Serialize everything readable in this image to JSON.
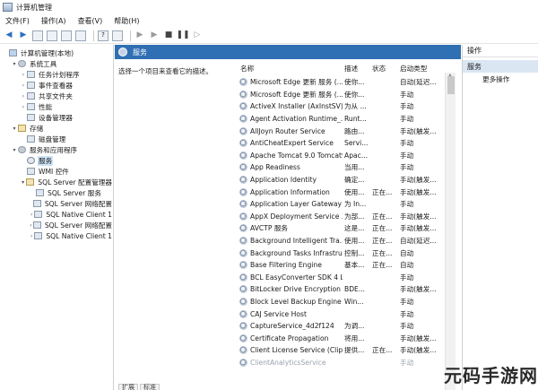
{
  "window": {
    "title": "计算机管理"
  },
  "menu": [
    "文件(F)",
    "操作(A)",
    "查看(V)",
    "帮助(H)"
  ],
  "toolbar": {
    "icons": [
      "back-arrow-icon",
      "forward-arrow-icon",
      "folder-icon",
      "properties-icon",
      "refresh-icon",
      "export-icon",
      "help-icon",
      "console-icon",
      "play-icon",
      "play-alt-icon",
      "stop-icon",
      "pause-icon",
      "restart-icon"
    ]
  },
  "tree": {
    "items": [
      {
        "label": "计算机管理(本地)",
        "indent": 0,
        "arrow": "",
        "icon": "mon"
      },
      {
        "label": "系统工具",
        "indent": 1,
        "arrow": "v",
        "icon": "gear"
      },
      {
        "label": "任务计划程序",
        "indent": 2,
        "arrow": ">",
        "icon": "box"
      },
      {
        "label": "事件查看器",
        "indent": 2,
        "arrow": ">",
        "icon": "box"
      },
      {
        "label": "共享文件夹",
        "indent": 2,
        "arrow": ">",
        "icon": "box"
      },
      {
        "label": "性能",
        "indent": 2,
        "arrow": ">",
        "icon": "box"
      },
      {
        "label": "设备管理器",
        "indent": 2,
        "arrow": "",
        "icon": "box"
      },
      {
        "label": "存储",
        "indent": 1,
        "arrow": "v",
        "icon": "db"
      },
      {
        "label": "磁盘管理",
        "indent": 2,
        "arrow": "",
        "icon": "box"
      },
      {
        "label": "服务和应用程序",
        "indent": 1,
        "arrow": "v",
        "icon": "gear"
      },
      {
        "label": "服务",
        "indent": 2,
        "arrow": "",
        "icon": "svc",
        "selected": true
      },
      {
        "label": "WMI 控件",
        "indent": 2,
        "arrow": "",
        "icon": "box"
      },
      {
        "label": "SQL Server 配置管理器",
        "indent": 2,
        "arrow": "v",
        "icon": "db"
      },
      {
        "label": "SQL Server 服务",
        "indent": 3,
        "arrow": "",
        "icon": "box"
      },
      {
        "label": "SQL Server 网络配置",
        "indent": 3,
        "arrow": "",
        "icon": "box"
      },
      {
        "label": "SQL Native Client 1",
        "indent": 3,
        "arrow": ">",
        "icon": "box"
      },
      {
        "label": "SQL Server 网络配置",
        "indent": 3,
        "arrow": ">",
        "icon": "box"
      },
      {
        "label": "SQL Native Client 1",
        "indent": 3,
        "arrow": ">",
        "icon": "box"
      }
    ]
  },
  "services_panel": {
    "header": "服务",
    "description_hint": "选择一个项目来查看它的描述。",
    "columns": {
      "name": "名称",
      "desc": "描述",
      "status": "状态",
      "startup": "启动类型"
    },
    "rows": [
      {
        "name": "Microsoft Edge 更新 服务 (...",
        "desc": "使你...",
        "status": "",
        "startup": "自动(延迟..."
      },
      {
        "name": "Microsoft Edge 更新 服务 (...",
        "desc": "使你...",
        "status": "",
        "startup": "手动"
      },
      {
        "name": "ActiveX Installer (AxInstSV)",
        "desc": "为从 ...",
        "status": "",
        "startup": "手动"
      },
      {
        "name": "Agent Activation Runtime_...",
        "desc": "Runt...",
        "status": "",
        "startup": "手动"
      },
      {
        "name": "AllJoyn Router Service",
        "desc": "路由...",
        "status": "",
        "startup": "手动(触发..."
      },
      {
        "name": "AntiCheatExpert Service",
        "desc": "Servi...",
        "status": "",
        "startup": "手动"
      },
      {
        "name": "Apache Tomcat 9.0 Tomcat9",
        "desc": "Apac...",
        "status": "",
        "startup": "手动"
      },
      {
        "name": "App Readiness",
        "desc": "当用...",
        "status": "",
        "startup": "手动"
      },
      {
        "name": "Application Identity",
        "desc": "确定...",
        "status": "",
        "startup": "手动(触发..."
      },
      {
        "name": "Application Information",
        "desc": "使用...",
        "status": "正在...",
        "startup": "手动(触发..."
      },
      {
        "name": "Application Layer Gateway ...",
        "desc": "为 In...",
        "status": "",
        "startup": "手动"
      },
      {
        "name": "AppX Deployment Service ...",
        "desc": "为部...",
        "status": "正在...",
        "startup": "手动(触发..."
      },
      {
        "name": "AVCTP 服务",
        "desc": "这是...",
        "status": "正在...",
        "startup": "手动(触发..."
      },
      {
        "name": "Background Intelligent Tra...",
        "desc": "使用...",
        "status": "正在...",
        "startup": "自动(延迟..."
      },
      {
        "name": "Background Tasks Infrastru...",
        "desc": "控制...",
        "status": "正在...",
        "startup": "自动"
      },
      {
        "name": "Base Filtering Engine",
        "desc": "基本...",
        "status": "正在...",
        "startup": "自动"
      },
      {
        "name": "BCL EasyConverter SDK 4 L...",
        "desc": "",
        "status": "",
        "startup": "手动"
      },
      {
        "name": "BitLocker Drive Encryption ...",
        "desc": "BDE...",
        "status": "",
        "startup": "手动(触发..."
      },
      {
        "name": "Block Level Backup Engine ...",
        "desc": "Win...",
        "status": "",
        "startup": "手动"
      },
      {
        "name": "CAJ Service Host",
        "desc": "",
        "status": "",
        "startup": "手动"
      },
      {
        "name": "CaptureService_4d2f124",
        "desc": "为调...",
        "status": "",
        "startup": "手动"
      },
      {
        "name": "Certificate Propagation",
        "desc": "将用...",
        "status": "",
        "startup": "手动(触发..."
      },
      {
        "name": "Client License Service (Clip...",
        "desc": "提供...",
        "status": "正在...",
        "startup": "手动(触发..."
      },
      {
        "name": "ClientAnalyticsService",
        "desc": "",
        "status": "",
        "startup": "手动",
        "faded": true
      }
    ],
    "bottom_tabs": [
      "扩展",
      "标准"
    ]
  },
  "actions_panel": {
    "title": "操作",
    "section": "服务",
    "item": "更多操作"
  },
  "watermark": "元码手游网"
}
